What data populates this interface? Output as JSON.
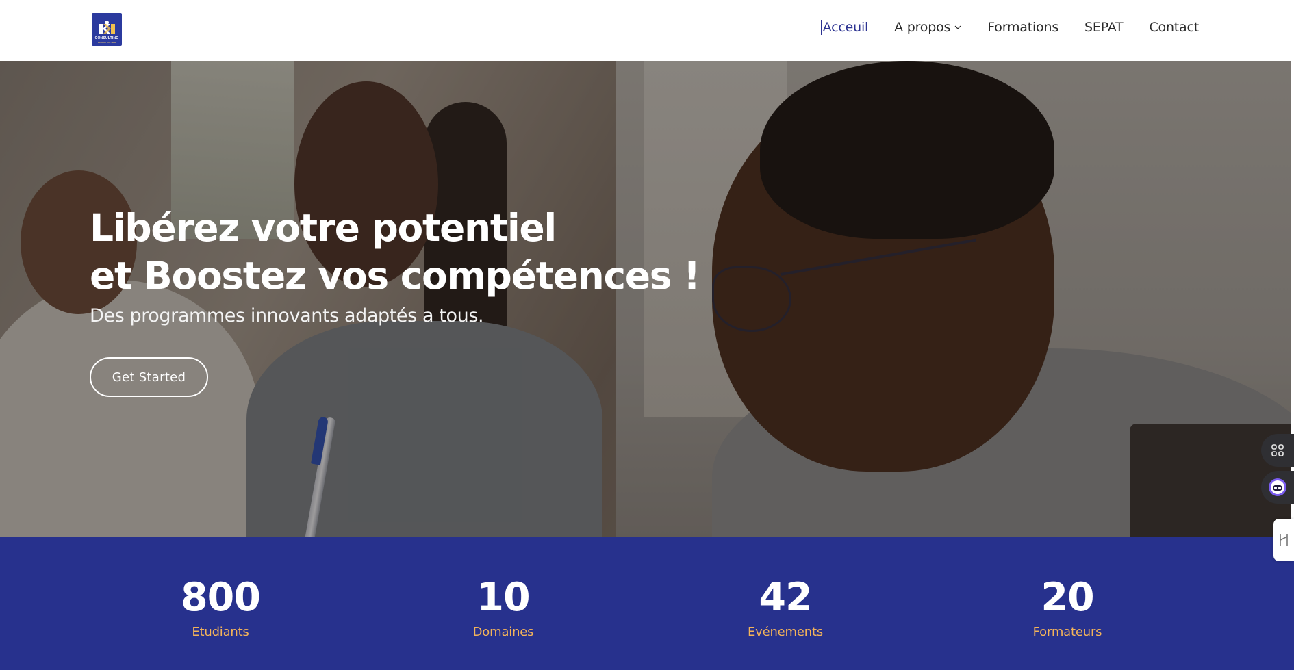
{
  "header": {
    "logo": {
      "text": "CONSULTING",
      "tagline": "we boost your skills"
    },
    "nav": [
      {
        "label": "Acceuil",
        "active": true
      },
      {
        "label": "A propos",
        "has_dropdown": true
      },
      {
        "label": "Formations"
      },
      {
        "label": "SEPAT"
      },
      {
        "label": "Contact"
      }
    ]
  },
  "hero": {
    "title_line1": "Libérez votre potentiel",
    "title_line2": "et Boostez vos compétences !",
    "subtitle": "Des programmes innovants adaptés a tous.",
    "cta_label": "Get Started"
  },
  "stats": [
    {
      "value": "800",
      "label": "Etudiants"
    },
    {
      "value": "10",
      "label": "Domaines"
    },
    {
      "value": "42",
      "label": "Evénements"
    },
    {
      "value": "20",
      "label": "Formateurs"
    }
  ],
  "side_tools": {
    "apps_icon": "apps-grid-icon",
    "bot_icon": "assistant-bot-icon",
    "tab_icon": "drag-handle-icon"
  },
  "colors": {
    "brand": "#27318d",
    "accent": "#f2b35a",
    "nav_active": "#2b3291"
  }
}
